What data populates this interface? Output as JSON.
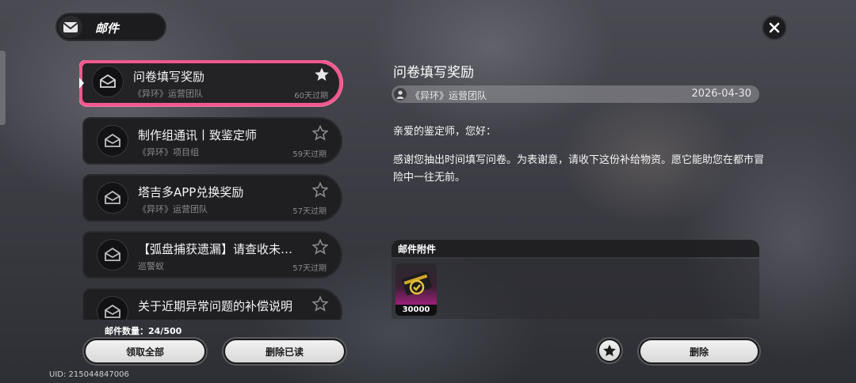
{
  "header": {
    "title": "邮件"
  },
  "mail_list": [
    {
      "title": "问卷填写奖励",
      "sender": "《异环》运营团队",
      "expires": "60天过期",
      "selected": true
    },
    {
      "title": "制作组通讯丨致鉴定师",
      "sender": "《异环》项目组",
      "expires": "59天过期",
      "selected": false
    },
    {
      "title": "塔吉多APP兑换奖励",
      "sender": "《异环》运营团队",
      "expires": "57天过期",
      "selected": false
    },
    {
      "title": "【弧盘捕获遗漏】请查收未…",
      "sender": "巡警蚁",
      "expires": "57天过期",
      "selected": false
    },
    {
      "title": "关于近期异常问题的补偿说明",
      "sender": "",
      "expires": "",
      "selected": false
    }
  ],
  "footer": {
    "mail_count_label": "邮件数量：",
    "mail_count": "24/500",
    "claim_all_label": "领取全部",
    "delete_read_label": "删除已读",
    "uid": "UID: 215044847006"
  },
  "detail": {
    "title": "问卷填写奖励",
    "sender": "《异环》运营团队",
    "date": "2026-04-30",
    "greeting": "亲爱的鉴定师，您好：",
    "body": "感谢您抽出时间填写问卷。为表谢意，请收下这份补给物资。愿它能助您在都市冒险中一往无前。",
    "attachments_label": "邮件附件",
    "attachments": [
      {
        "quantity": "30000",
        "icon": "gold-coin-card-icon"
      }
    ],
    "delete_label": "删除"
  },
  "colors": {
    "accent": "#f0588e",
    "panel": "#1f1f22"
  }
}
